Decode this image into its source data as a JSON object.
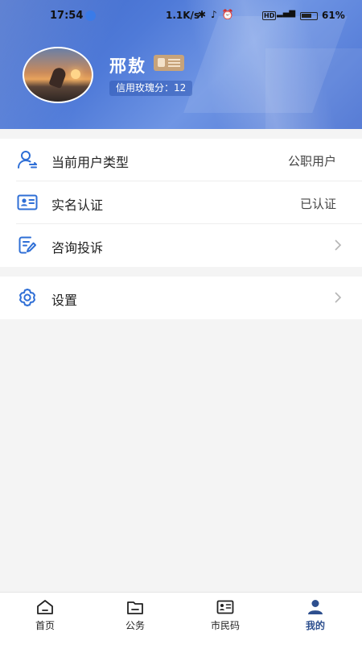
{
  "status_bar": {
    "time": "17:54",
    "speed": "1.1K/s",
    "network_badge": "HD",
    "battery": "61%"
  },
  "profile": {
    "name": "邢敖",
    "credit": "信用玫瑰分：12"
  },
  "menu": [
    {
      "label": "当前用户类型",
      "value": "公职用户",
      "icon": "user-type-icon"
    },
    {
      "label": "实名认证",
      "value": "已认证",
      "icon": "id-card-icon"
    },
    {
      "label": "咨询投诉",
      "value": "",
      "icon": "edit-document-icon"
    }
  ],
  "settings": {
    "label": "设置",
    "icon": "gear-icon"
  },
  "tabbar": [
    {
      "label": "首页",
      "icon": "home-icon"
    },
    {
      "label": "公务",
      "icon": "folder-icon"
    },
    {
      "label": "市民码",
      "icon": "citizen-card-icon"
    },
    {
      "label": "我的",
      "icon": "person-icon",
      "active": true
    }
  ],
  "colors": {
    "accent": "#2f6fd6",
    "header": "#4a72d2",
    "active_tab": "#2d4f8e"
  }
}
